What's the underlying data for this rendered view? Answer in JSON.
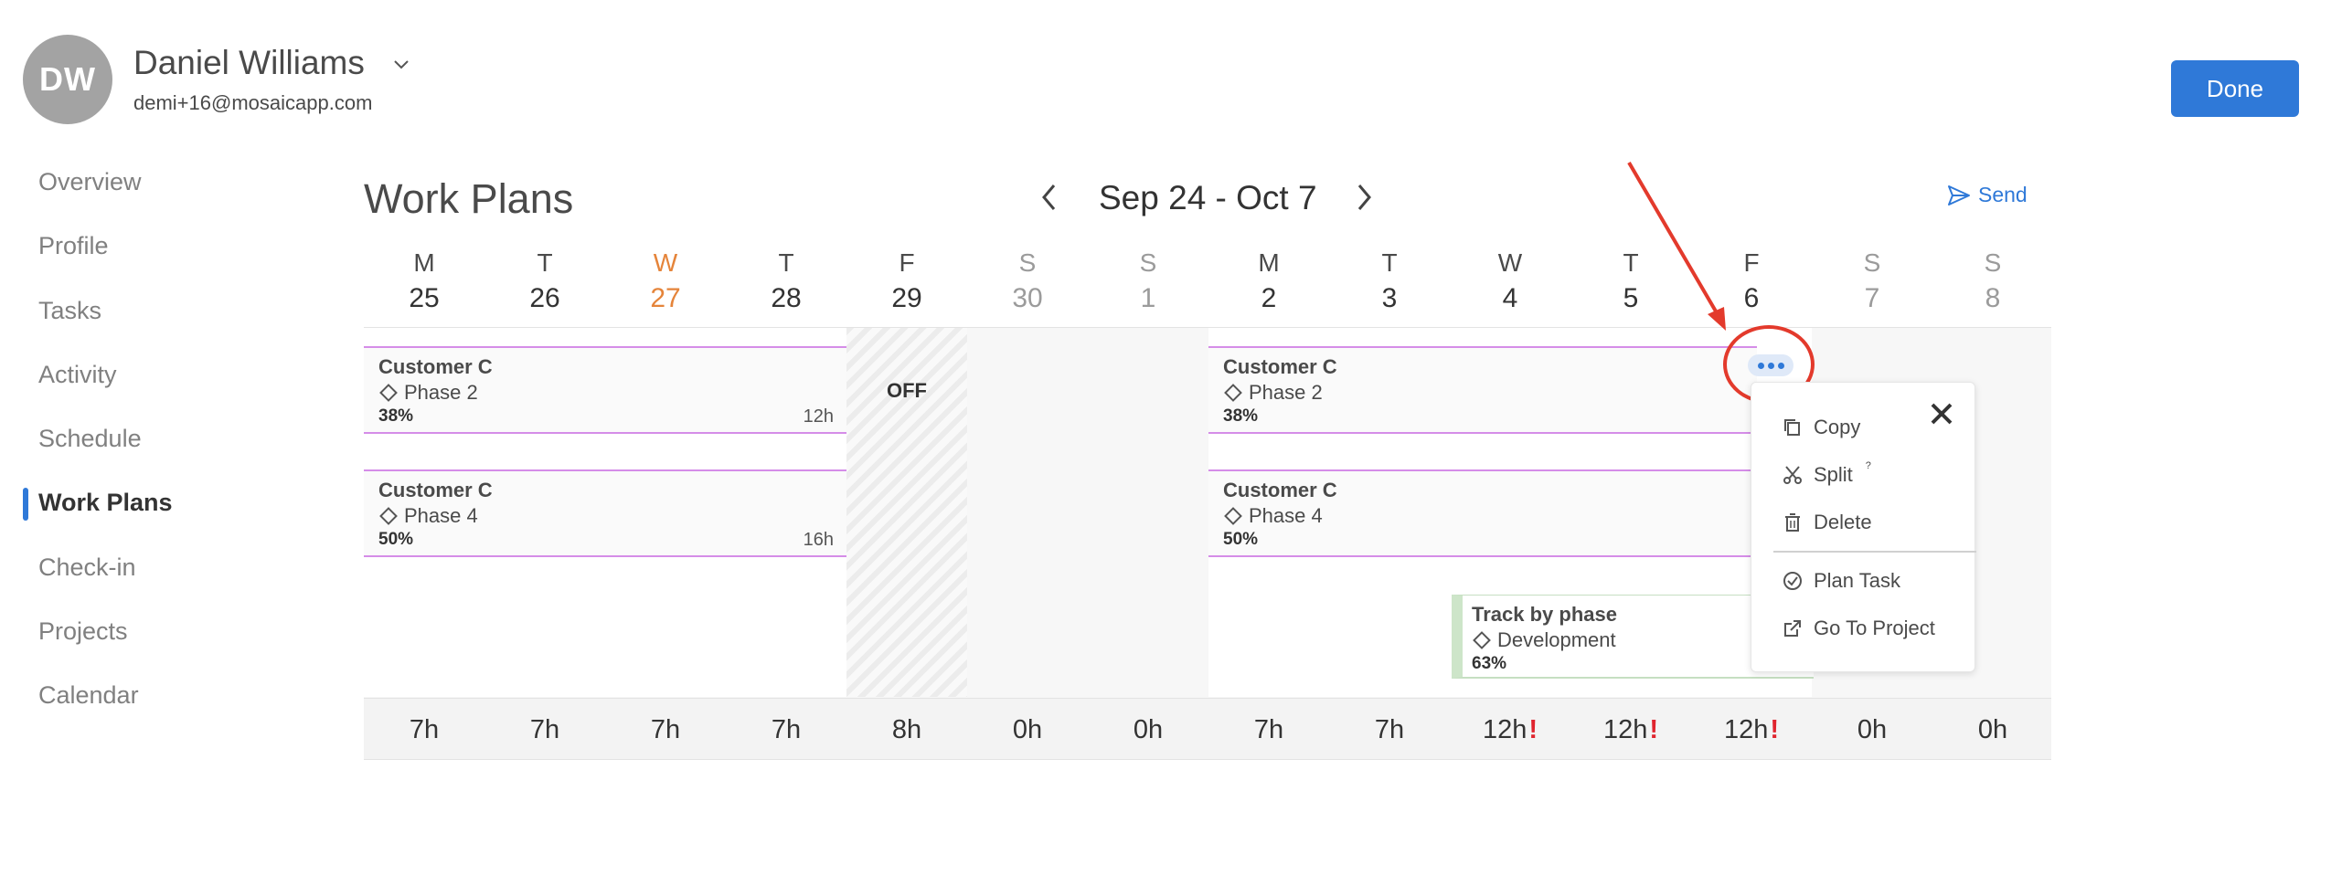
{
  "user": {
    "initials": "DW",
    "name": "Daniel Williams",
    "email": "demi+16@mosaicapp.com"
  },
  "header": {
    "done_label": "Done"
  },
  "sidebar": {
    "items": [
      {
        "label": "Overview"
      },
      {
        "label": "Profile"
      },
      {
        "label": "Tasks"
      },
      {
        "label": "Activity"
      },
      {
        "label": "Schedule"
      },
      {
        "label": "Work Plans",
        "active": true
      },
      {
        "label": "Check-in"
      },
      {
        "label": "Projects"
      },
      {
        "label": "Calendar"
      }
    ]
  },
  "workplans": {
    "title": "Work Plans",
    "date_range": "Sep 24 - Oct 7",
    "send_label": "Send",
    "days": [
      {
        "letter": "M",
        "num": "25"
      },
      {
        "letter": "T",
        "num": "26"
      },
      {
        "letter": "W",
        "num": "27",
        "today": true
      },
      {
        "letter": "T",
        "num": "28"
      },
      {
        "letter": "F",
        "num": "29"
      },
      {
        "letter": "S",
        "num": "30",
        "weekend": true
      },
      {
        "letter": "S",
        "num": "1",
        "weekend": true
      },
      {
        "letter": "M",
        "num": "2"
      },
      {
        "letter": "T",
        "num": "3"
      },
      {
        "letter": "W",
        "num": "4"
      },
      {
        "letter": "T",
        "num": "5"
      },
      {
        "letter": "F",
        "num": "6"
      },
      {
        "letter": "S",
        "num": "7",
        "weekend": true
      },
      {
        "letter": "S",
        "num": "8",
        "weekend": true
      }
    ],
    "off_label": "OFF",
    "bars": [
      {
        "title": "Customer C",
        "phase": "Phase 2",
        "percent": "38%",
        "hours": "12h"
      },
      {
        "title": "Customer C",
        "phase": "Phase 4",
        "percent": "50%",
        "hours": "16h"
      },
      {
        "title": "Customer C",
        "phase": "Phase 2",
        "percent": "38%",
        "hours": ""
      },
      {
        "title": "Customer C",
        "phase": "Phase 4",
        "percent": "50%",
        "hours": ""
      }
    ],
    "track_bar": {
      "title": "Track by phase",
      "phase": "Development",
      "percent": "63%"
    },
    "totals": [
      {
        "value": "7h"
      },
      {
        "value": "7h"
      },
      {
        "value": "7h"
      },
      {
        "value": "7h"
      },
      {
        "value": "8h"
      },
      {
        "value": "0h"
      },
      {
        "value": "0h"
      },
      {
        "value": "7h"
      },
      {
        "value": "7h"
      },
      {
        "value": "12h",
        "warn": "!"
      },
      {
        "value": "12h",
        "warn": "!"
      },
      {
        "value": "12h",
        "warn": "!"
      },
      {
        "value": "0h"
      },
      {
        "value": "0h"
      }
    ]
  },
  "context_menu": {
    "copy": "Copy",
    "split": "Split",
    "split_sup": "?",
    "delete": "Delete",
    "plan_task": "Plan Task",
    "go_to_project": "Go To Project"
  },
  "colors": {
    "accent": "#2f79d8",
    "today": "#e5843a",
    "bar_border": "#d58de8",
    "warning": "#e0242e",
    "annotation": "#e33a2c"
  }
}
